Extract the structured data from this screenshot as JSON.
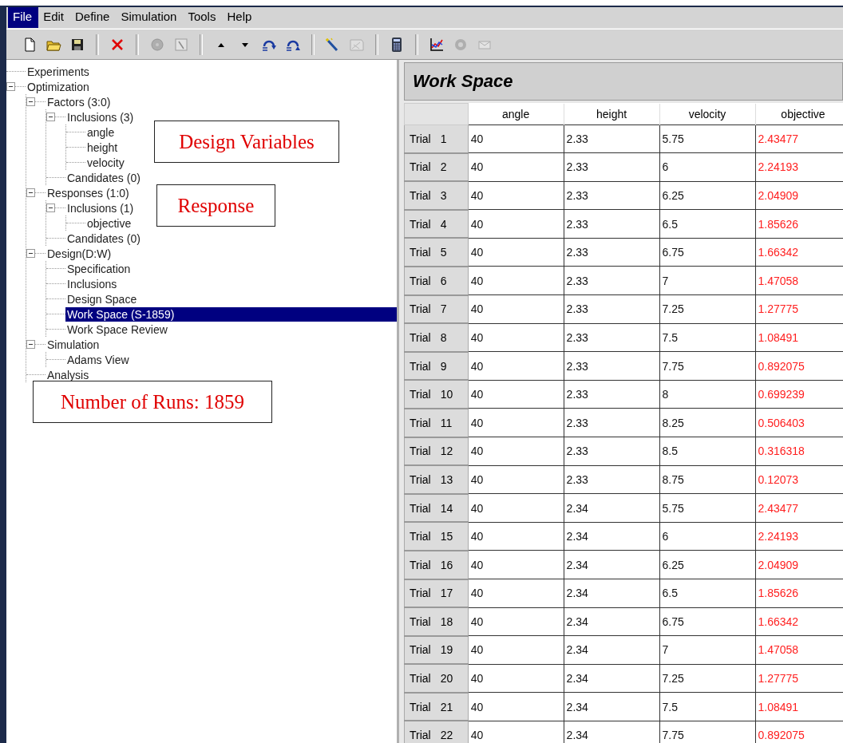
{
  "menu": [
    {
      "label": "File",
      "selected": true
    },
    {
      "label": "Edit",
      "selected": false
    },
    {
      "label": "Define",
      "selected": false
    },
    {
      "label": "Simulation",
      "selected": false
    },
    {
      "label": "Tools",
      "selected": false
    },
    {
      "label": "Help",
      "selected": false
    }
  ],
  "toolbar": [
    {
      "kind": "new",
      "disabled": false
    },
    {
      "kind": "open",
      "disabled": false
    },
    {
      "kind": "save",
      "disabled": false
    },
    {
      "kind": "sep"
    },
    {
      "kind": "delete",
      "disabled": false
    },
    {
      "kind": "sep"
    },
    {
      "kind": "disc",
      "disabled": true
    },
    {
      "kind": "gauge",
      "disabled": true
    },
    {
      "kind": "sep"
    },
    {
      "kind": "up",
      "disabled": false
    },
    {
      "kind": "down",
      "disabled": false
    },
    {
      "kind": "undo",
      "disabled": false
    },
    {
      "kind": "redo",
      "disabled": false
    },
    {
      "kind": "sep"
    },
    {
      "kind": "wand",
      "disabled": false
    },
    {
      "kind": "sheet",
      "disabled": true
    },
    {
      "kind": "sep"
    },
    {
      "kind": "calculator",
      "disabled": false
    },
    {
      "kind": "sep"
    },
    {
      "kind": "plot",
      "disabled": false
    },
    {
      "kind": "gear",
      "disabled": true
    },
    {
      "kind": "mail",
      "disabled": true
    }
  ],
  "tree": [
    {
      "label": "Experiments",
      "selected": false
    },
    {
      "label": "Optimization",
      "expanded": true,
      "selected": false,
      "children": [
        {
          "label": "Factors (3:0)",
          "expanded": true,
          "selected": false,
          "children": [
            {
              "label": "Inclusions (3)",
              "expanded": true,
              "selected": false,
              "children": [
                {
                  "label": "angle",
                  "selected": false
                },
                {
                  "label": "height",
                  "selected": false
                },
                {
                  "label": "velocity",
                  "selected": false
                }
              ]
            },
            {
              "label": "Candidates (0)",
              "selected": false
            }
          ]
        },
        {
          "label": "Responses (1:0)",
          "expanded": true,
          "selected": false,
          "children": [
            {
              "label": "Inclusions (1)",
              "expanded": true,
              "selected": false,
              "children": [
                {
                  "label": "objective",
                  "selected": false
                }
              ]
            },
            {
              "label": "Candidates (0)",
              "selected": false
            }
          ]
        },
        {
          "label": "Design(D:W)",
          "expanded": true,
          "selected": false,
          "children": [
            {
              "label": "Specification",
              "selected": false
            },
            {
              "label": "Inclusions",
              "selected": false
            },
            {
              "label": "Design Space",
              "selected": false
            },
            {
              "label": "Work Space (S-1859)",
              "selected": true
            },
            {
              "label": "Work Space Review",
              "selected": false
            }
          ]
        },
        {
          "label": "Simulation",
          "expanded": true,
          "selected": false,
          "children": [
            {
              "label": "Adams View",
              "selected": false
            }
          ]
        },
        {
          "label": "Analysis",
          "selected": false
        }
      ]
    }
  ],
  "callouts": [
    "Design Variables",
    "Response",
    "Number of Runs: 1859"
  ],
  "panel": {
    "title": "Work Space"
  },
  "table": {
    "columns": [
      {
        "label": "angle",
        "kind": "factor"
      },
      {
        "label": "height",
        "kind": "factor"
      },
      {
        "label": "velocity",
        "kind": "factor"
      },
      {
        "label": "objective",
        "kind": "response"
      }
    ],
    "rows": [
      {
        "label": "Trial",
        "number": "1",
        "cells": [
          "40",
          "2.33",
          "5.75",
          "2.43477"
        ]
      },
      {
        "label": "Trial",
        "number": "2",
        "cells": [
          "40",
          "2.33",
          "6",
          "2.24193"
        ]
      },
      {
        "label": "Trial",
        "number": "3",
        "cells": [
          "40",
          "2.33",
          "6.25",
          "2.04909"
        ]
      },
      {
        "label": "Trial",
        "number": "4",
        "cells": [
          "40",
          "2.33",
          "6.5",
          "1.85626"
        ]
      },
      {
        "label": "Trial",
        "number": "5",
        "cells": [
          "40",
          "2.33",
          "6.75",
          "1.66342"
        ]
      },
      {
        "label": "Trial",
        "number": "6",
        "cells": [
          "40",
          "2.33",
          "7",
          "1.47058"
        ]
      },
      {
        "label": "Trial",
        "number": "7",
        "cells": [
          "40",
          "2.33",
          "7.25",
          "1.27775"
        ]
      },
      {
        "label": "Trial",
        "number": "8",
        "cells": [
          "40",
          "2.33",
          "7.5",
          "1.08491"
        ]
      },
      {
        "label": "Trial",
        "number": "9",
        "cells": [
          "40",
          "2.33",
          "7.75",
          "0.892075"
        ]
      },
      {
        "label": "Trial",
        "number": "10",
        "cells": [
          "40",
          "2.33",
          "8",
          "0.699239"
        ]
      },
      {
        "label": "Trial",
        "number": "11",
        "cells": [
          "40",
          "2.33",
          "8.25",
          "0.506403"
        ]
      },
      {
        "label": "Trial",
        "number": "12",
        "cells": [
          "40",
          "2.33",
          "8.5",
          "0.316318"
        ]
      },
      {
        "label": "Trial",
        "number": "13",
        "cells": [
          "40",
          "2.33",
          "8.75",
          "0.12073"
        ]
      },
      {
        "label": "Trial",
        "number": "14",
        "cells": [
          "40",
          "2.34",
          "5.75",
          "2.43477"
        ]
      },
      {
        "label": "Trial",
        "number": "15",
        "cells": [
          "40",
          "2.34",
          "6",
          "2.24193"
        ]
      },
      {
        "label": "Trial",
        "number": "16",
        "cells": [
          "40",
          "2.34",
          "6.25",
          "2.04909"
        ]
      },
      {
        "label": "Trial",
        "number": "17",
        "cells": [
          "40",
          "2.34",
          "6.5",
          "1.85626"
        ]
      },
      {
        "label": "Trial",
        "number": "18",
        "cells": [
          "40",
          "2.34",
          "6.75",
          "1.66342"
        ]
      },
      {
        "label": "Trial",
        "number": "19",
        "cells": [
          "40",
          "2.34",
          "7",
          "1.47058"
        ]
      },
      {
        "label": "Trial",
        "number": "20",
        "cells": [
          "40",
          "2.34",
          "7.25",
          "1.27775"
        ]
      },
      {
        "label": "Trial",
        "number": "21",
        "cells": [
          "40",
          "2.34",
          "7.5",
          "1.08491"
        ]
      },
      {
        "label": "Trial",
        "number": "22",
        "cells": [
          "40",
          "2.34",
          "7.75",
          "0.892075"
        ]
      }
    ]
  }
}
